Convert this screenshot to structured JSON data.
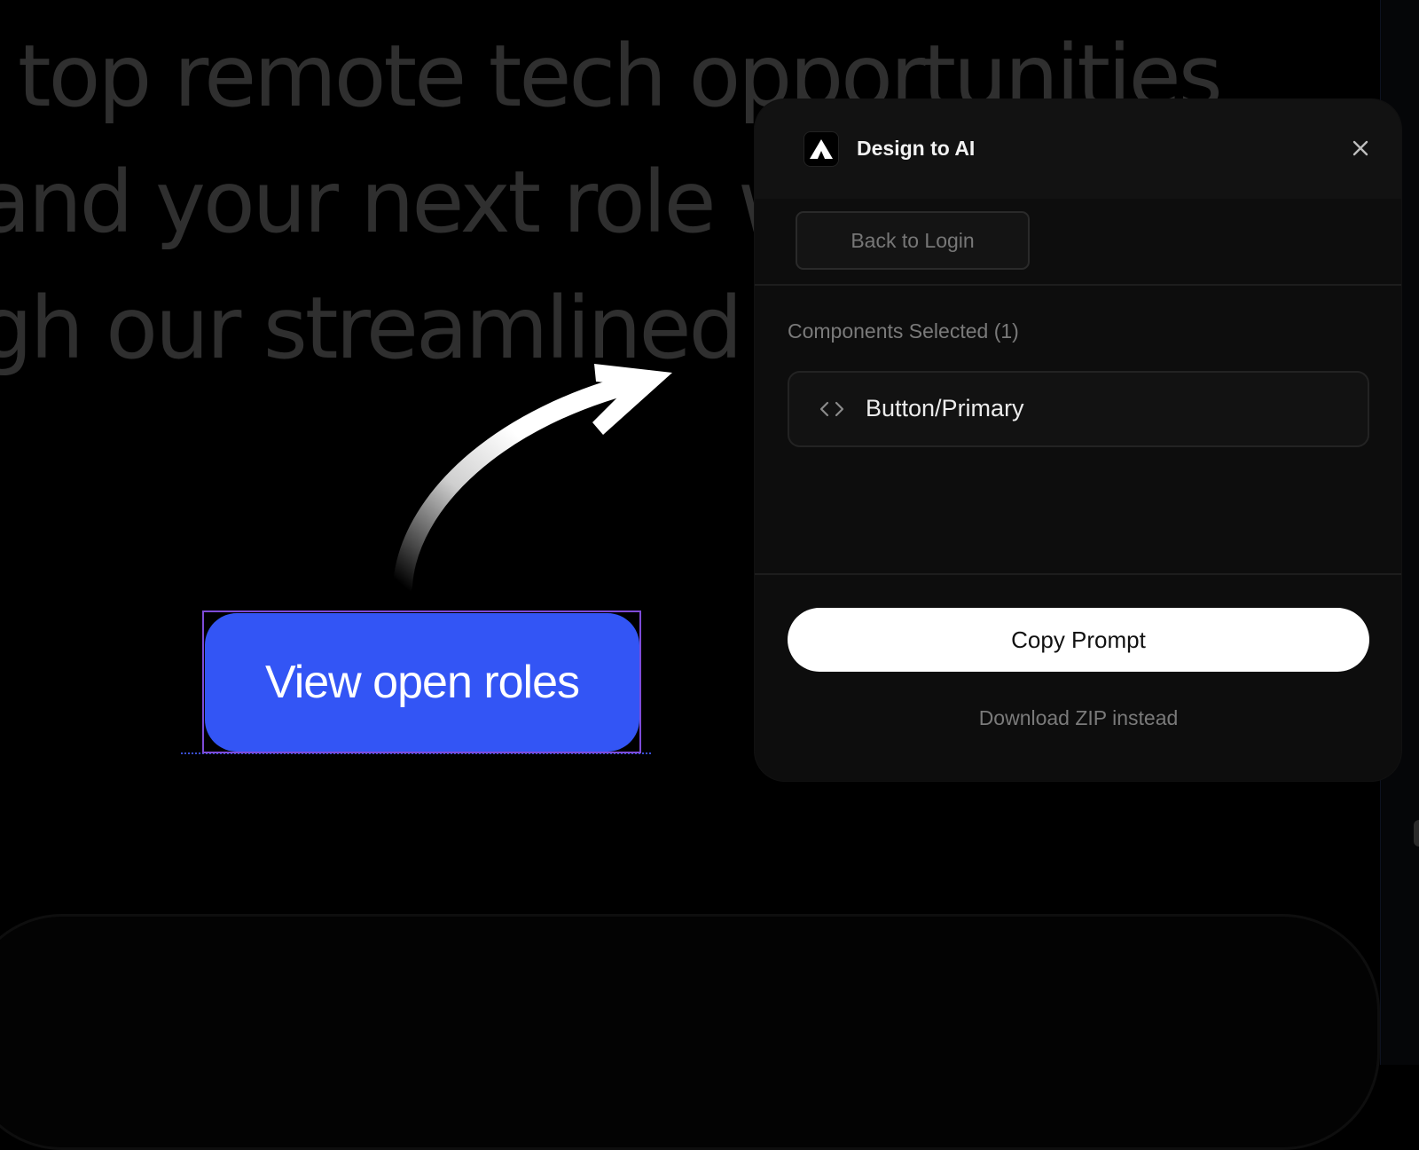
{
  "hero": {
    "line1": "r top remote tech opportunities",
    "line2": "and your next role w",
    "line3": "gh our streamlined"
  },
  "canvas": {
    "selected_button_label": "View open roles",
    "button_color": "#3355f5",
    "selection_color": "#7e4bd8"
  },
  "panel": {
    "title": "Design to AI",
    "back_label": "Back to Login",
    "section_label": "Components Selected (1)",
    "components": [
      {
        "name": "Button/Primary",
        "icon": "code-icon"
      }
    ],
    "copy_label": "Copy Prompt",
    "download_label": "Download ZIP instead"
  }
}
